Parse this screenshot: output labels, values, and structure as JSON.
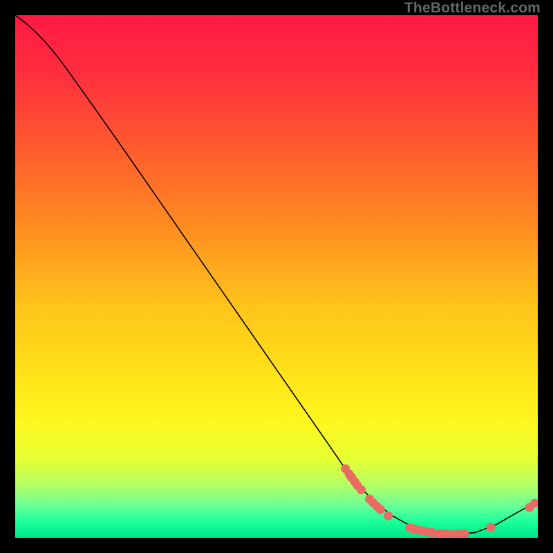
{
  "watermark": "TheBottleneck.com",
  "chart_data": {
    "type": "line",
    "title": "",
    "xlabel": "",
    "ylabel": "",
    "xlim": [
      0,
      100
    ],
    "ylim": [
      0,
      100
    ],
    "background_gradient": {
      "stops": [
        {
          "offset": 0.0,
          "color": "#ff1a44"
        },
        {
          "offset": 0.1,
          "color": "#ff2b3f"
        },
        {
          "offset": 0.25,
          "color": "#ff5a2f"
        },
        {
          "offset": 0.4,
          "color": "#ff8b22"
        },
        {
          "offset": 0.55,
          "color": "#ffc21a"
        },
        {
          "offset": 0.7,
          "color": "#ffe51a"
        },
        {
          "offset": 0.78,
          "color": "#fff71f"
        },
        {
          "offset": 0.85,
          "color": "#e6ff33"
        },
        {
          "offset": 0.9,
          "color": "#b3ff66"
        },
        {
          "offset": 0.94,
          "color": "#66ff99"
        },
        {
          "offset": 0.97,
          "color": "#1aff99"
        },
        {
          "offset": 1.0,
          "color": "#00e688"
        }
      ]
    },
    "curve": [
      {
        "x": 0.0,
        "y": 100.0
      },
      {
        "x": 2.0,
        "y": 98.5
      },
      {
        "x": 4.0,
        "y": 96.7
      },
      {
        "x": 6.0,
        "y": 94.6
      },
      {
        "x": 8.0,
        "y": 92.2
      },
      {
        "x": 10.0,
        "y": 89.5
      },
      {
        "x": 12.0,
        "y": 86.7
      },
      {
        "x": 15.0,
        "y": 82.5
      },
      {
        "x": 20.0,
        "y": 75.4
      },
      {
        "x": 25.0,
        "y": 68.2
      },
      {
        "x": 30.0,
        "y": 61.0
      },
      {
        "x": 35.0,
        "y": 53.8
      },
      {
        "x": 40.0,
        "y": 46.6
      },
      {
        "x": 45.0,
        "y": 39.4
      },
      {
        "x": 50.0,
        "y": 32.2
      },
      {
        "x": 55.0,
        "y": 25.0
      },
      {
        "x": 60.0,
        "y": 17.8
      },
      {
        "x": 64.0,
        "y": 12.0
      },
      {
        "x": 68.0,
        "y": 7.6
      },
      {
        "x": 72.0,
        "y": 4.3
      },
      {
        "x": 76.0,
        "y": 2.1
      },
      {
        "x": 80.0,
        "y": 0.9
      },
      {
        "x": 84.0,
        "y": 0.6
      },
      {
        "x": 88.0,
        "y": 1.0
      },
      {
        "x": 92.0,
        "y": 2.5
      },
      {
        "x": 96.0,
        "y": 4.8
      },
      {
        "x": 100.0,
        "y": 7.0
      }
    ],
    "markers": [
      {
        "x": 63.2,
        "y": 13.2
      },
      {
        "x": 63.9,
        "y": 12.2
      },
      {
        "x": 64.1,
        "y": 11.9
      },
      {
        "x": 64.4,
        "y": 11.5
      },
      {
        "x": 65.0,
        "y": 10.7
      },
      {
        "x": 65.5,
        "y": 10.0
      },
      {
        "x": 66.2,
        "y": 9.2
      },
      {
        "x": 67.8,
        "y": 7.4
      },
      {
        "x": 68.5,
        "y": 6.7
      },
      {
        "x": 69.2,
        "y": 6.0
      },
      {
        "x": 69.9,
        "y": 5.4
      },
      {
        "x": 71.4,
        "y": 4.2
      },
      {
        "x": 75.5,
        "y": 1.9
      },
      {
        "x": 76.0,
        "y": 1.8
      },
      {
        "x": 76.5,
        "y": 1.6
      },
      {
        "x": 77.2,
        "y": 1.5
      },
      {
        "x": 78.0,
        "y": 1.3
      },
      {
        "x": 79.0,
        "y": 1.1
      },
      {
        "x": 79.8,
        "y": 1.0
      },
      {
        "x": 81.0,
        "y": 0.8
      },
      {
        "x": 81.3,
        "y": 0.8
      },
      {
        "x": 81.7,
        "y": 0.7
      },
      {
        "x": 82.5,
        "y": 0.7
      },
      {
        "x": 83.4,
        "y": 0.6
      },
      {
        "x": 84.3,
        "y": 0.6
      },
      {
        "x": 85.1,
        "y": 0.7
      },
      {
        "x": 86.0,
        "y": 0.8
      },
      {
        "x": 91.0,
        "y": 2.0
      },
      {
        "x": 98.4,
        "y": 5.8
      },
      {
        "x": 99.4,
        "y": 6.6
      }
    ],
    "marker_color": "#ea6a64",
    "curve_color": "#000000"
  }
}
